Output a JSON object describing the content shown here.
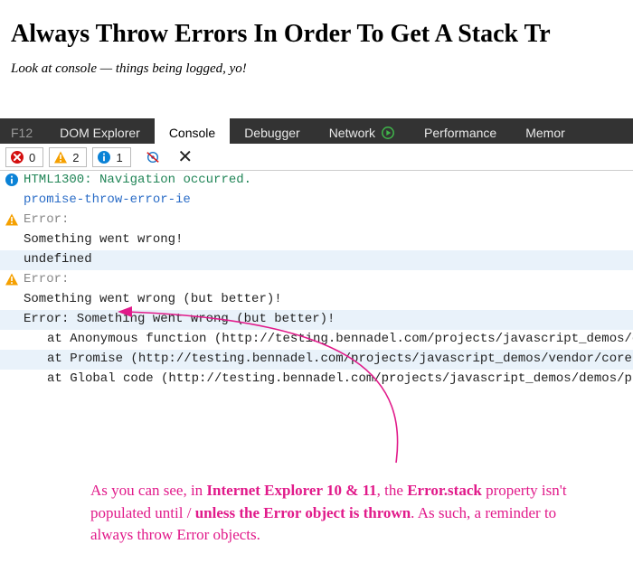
{
  "page": {
    "title": "Always Throw Errors In Order To Get A Stack Tr",
    "subtitle": "Look at console — things being logged, yo!"
  },
  "devtools": {
    "tabs": {
      "f12": "F12",
      "dom": "DOM Explorer",
      "console": "Console",
      "debugger": "Debugger",
      "network": "Network",
      "performance": "Performance",
      "memory": "Memor"
    },
    "counts": {
      "errors": "0",
      "warnings": "2",
      "info": "1"
    }
  },
  "console": {
    "entries": {
      "info_code": "HTML1300",
      "info_text": "Navigation occurred.",
      "info_source": "promise-throw-error-ie",
      "warn1_label": "Error:",
      "warn1_line1": "Something went wrong!",
      "warn1_line2": "undefined",
      "warn2_label": "Error:",
      "warn2_line1": "Something went wrong (but better)!",
      "warn2_trace0": "Error: Something went wrong (but better)!",
      "warn2_trace1": "   at Anonymous function (http://testing.bennadel.com/projects/javascript_demos/de",
      "warn2_trace2": "   at Promise (http://testing.bennadel.com/projects/javascript_demos/vendor/core-j",
      "warn2_trace3": "   at Global code (http://testing.bennadel.com/projects/javascript_demos/demos/pro"
    }
  },
  "annotation": {
    "seg1": "As you can see, in ",
    "seg2": "Internet Explorer 10 & 11",
    "seg3": ", the ",
    "seg4": "Error.stack",
    "seg5": " property isn't populated until / ",
    "seg6": "unless the Error object is thrown",
    "seg7": ". As such, a reminder to always throw Error objects."
  }
}
